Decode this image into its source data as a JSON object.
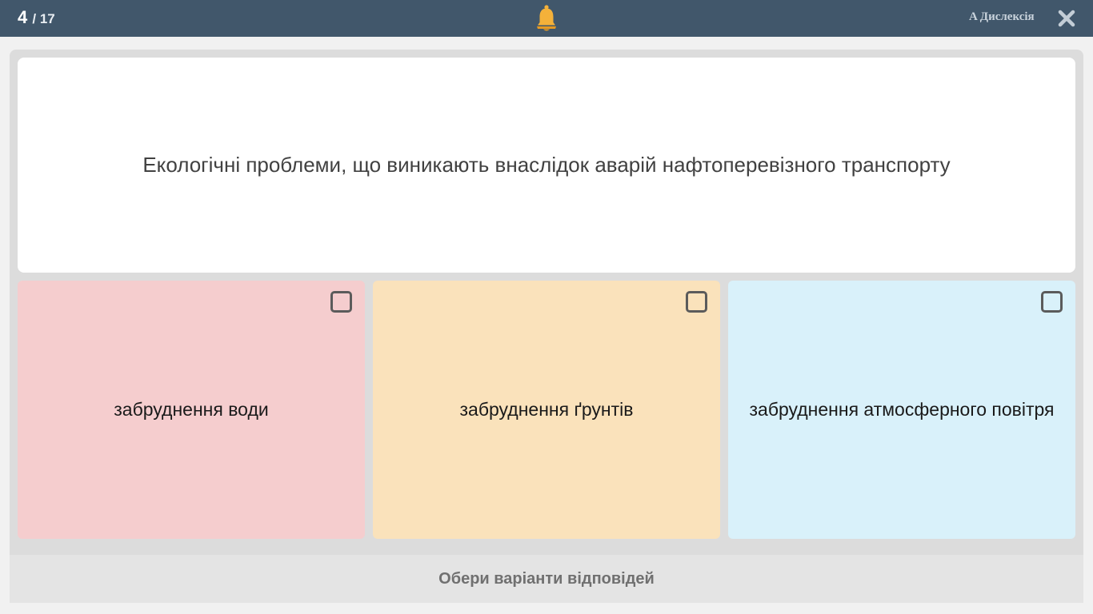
{
  "header": {
    "current": "4",
    "total": "/ 17",
    "bell_icon": "bell-icon",
    "bell_color": "#f4b13a",
    "dyslexia_label": "A Дислексія",
    "close_icon": "close-icon"
  },
  "question": {
    "text": "Екологічні проблеми, що виникають внаслідок аварій нафтоперевізного транспорту"
  },
  "options": [
    {
      "label": "забруднення води",
      "color": "#f5cdce",
      "checked": false
    },
    {
      "label": "забруднення ґрунтів",
      "color": "#fae2bb",
      "checked": false
    },
    {
      "label": "забруднення атмосферного повітря",
      "color": "#d9f1fa",
      "checked": false
    }
  ],
  "footer": {
    "hint": "Обери варіанти відповідей"
  },
  "colors": {
    "topbar": "#41576b",
    "panel": "#dcdcdc"
  }
}
